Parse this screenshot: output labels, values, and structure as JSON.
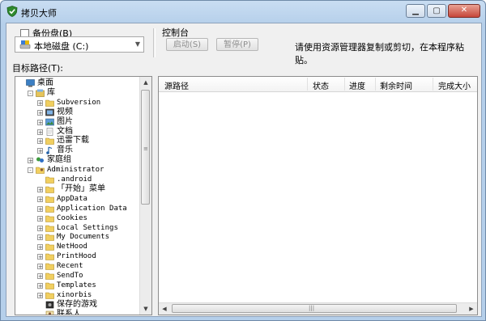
{
  "window": {
    "title": "拷贝大师"
  },
  "backup": {
    "label": "备份盘(B)",
    "checked": false,
    "drive_value": "本地磁盘 (C:)"
  },
  "control": {
    "label": "控制台",
    "start_label": "启动(S)",
    "pause_label": "暂停(P)",
    "hint": "请使用资源管理器复制或剪切，在本程序粘贴。"
  },
  "target": {
    "label": "目标路径(T):"
  },
  "tree": {
    "rows": [
      {
        "label": "桌面",
        "icon": "desktop-icon",
        "expander": "",
        "mono": false
      },
      {
        "label": "库",
        "icon": "library-icon",
        "expander": "-",
        "mono": false
      },
      {
        "label": "Subversion",
        "icon": "folder-icon",
        "expander": "+",
        "mono": true
      },
      {
        "label": "视频",
        "icon": "video-icon",
        "expander": "+",
        "mono": false
      },
      {
        "label": "图片",
        "icon": "picture-icon",
        "expander": "+",
        "mono": false
      },
      {
        "label": "文档",
        "icon": "document-icon",
        "expander": "+",
        "mono": false
      },
      {
        "label": "迅雷下载",
        "icon": "folder-icon",
        "expander": "+",
        "mono": false
      },
      {
        "label": "音乐",
        "icon": "music-icon",
        "expander": "+",
        "mono": false
      },
      {
        "label": "家庭组",
        "icon": "homegroup-icon",
        "expander": "+",
        "mono": false
      },
      {
        "label": "Administrator",
        "icon": "user-folder-icon",
        "expander": "-",
        "mono": true
      },
      {
        "label": ".android",
        "icon": "folder-icon",
        "expander": "",
        "mono": true
      },
      {
        "label": "「开始」菜单",
        "icon": "folder-icon",
        "expander": "+",
        "mono": false
      },
      {
        "label": "AppData",
        "icon": "folder-icon",
        "expander": "+",
        "mono": true
      },
      {
        "label": "Application Data",
        "icon": "folder-icon",
        "expander": "+",
        "mono": true
      },
      {
        "label": "Cookies",
        "icon": "folder-icon",
        "expander": "+",
        "mono": true
      },
      {
        "label": "Local Settings",
        "icon": "folder-icon",
        "expander": "+",
        "mono": true
      },
      {
        "label": "My Documents",
        "icon": "folder-icon",
        "expander": "+",
        "mono": true
      },
      {
        "label": "NetHood",
        "icon": "folder-icon",
        "expander": "+",
        "mono": true
      },
      {
        "label": "PrintHood",
        "icon": "folder-icon",
        "expander": "+",
        "mono": true
      },
      {
        "label": "Recent",
        "icon": "folder-icon",
        "expander": "+",
        "mono": true
      },
      {
        "label": "SendTo",
        "icon": "folder-icon",
        "expander": "+",
        "mono": true
      },
      {
        "label": "Templates",
        "icon": "folder-icon",
        "expander": "+",
        "mono": true
      },
      {
        "label": "xinorbis",
        "icon": "folder-icon",
        "expander": "+",
        "mono": true
      },
      {
        "label": "保存的游戏",
        "icon": "saved-games-icon",
        "expander": "",
        "mono": false
      },
      {
        "label": "联系人",
        "icon": "contacts-icon",
        "expander": "",
        "mono": false
      }
    ]
  },
  "list": {
    "columns": [
      "源路径",
      "状态",
      "进度",
      "剩余时间",
      "完成大小"
    ]
  },
  "colors": {
    "title_bg": "#c9ddf2",
    "client_bg": "#f0f0f0",
    "close_red": "#c6463a"
  }
}
